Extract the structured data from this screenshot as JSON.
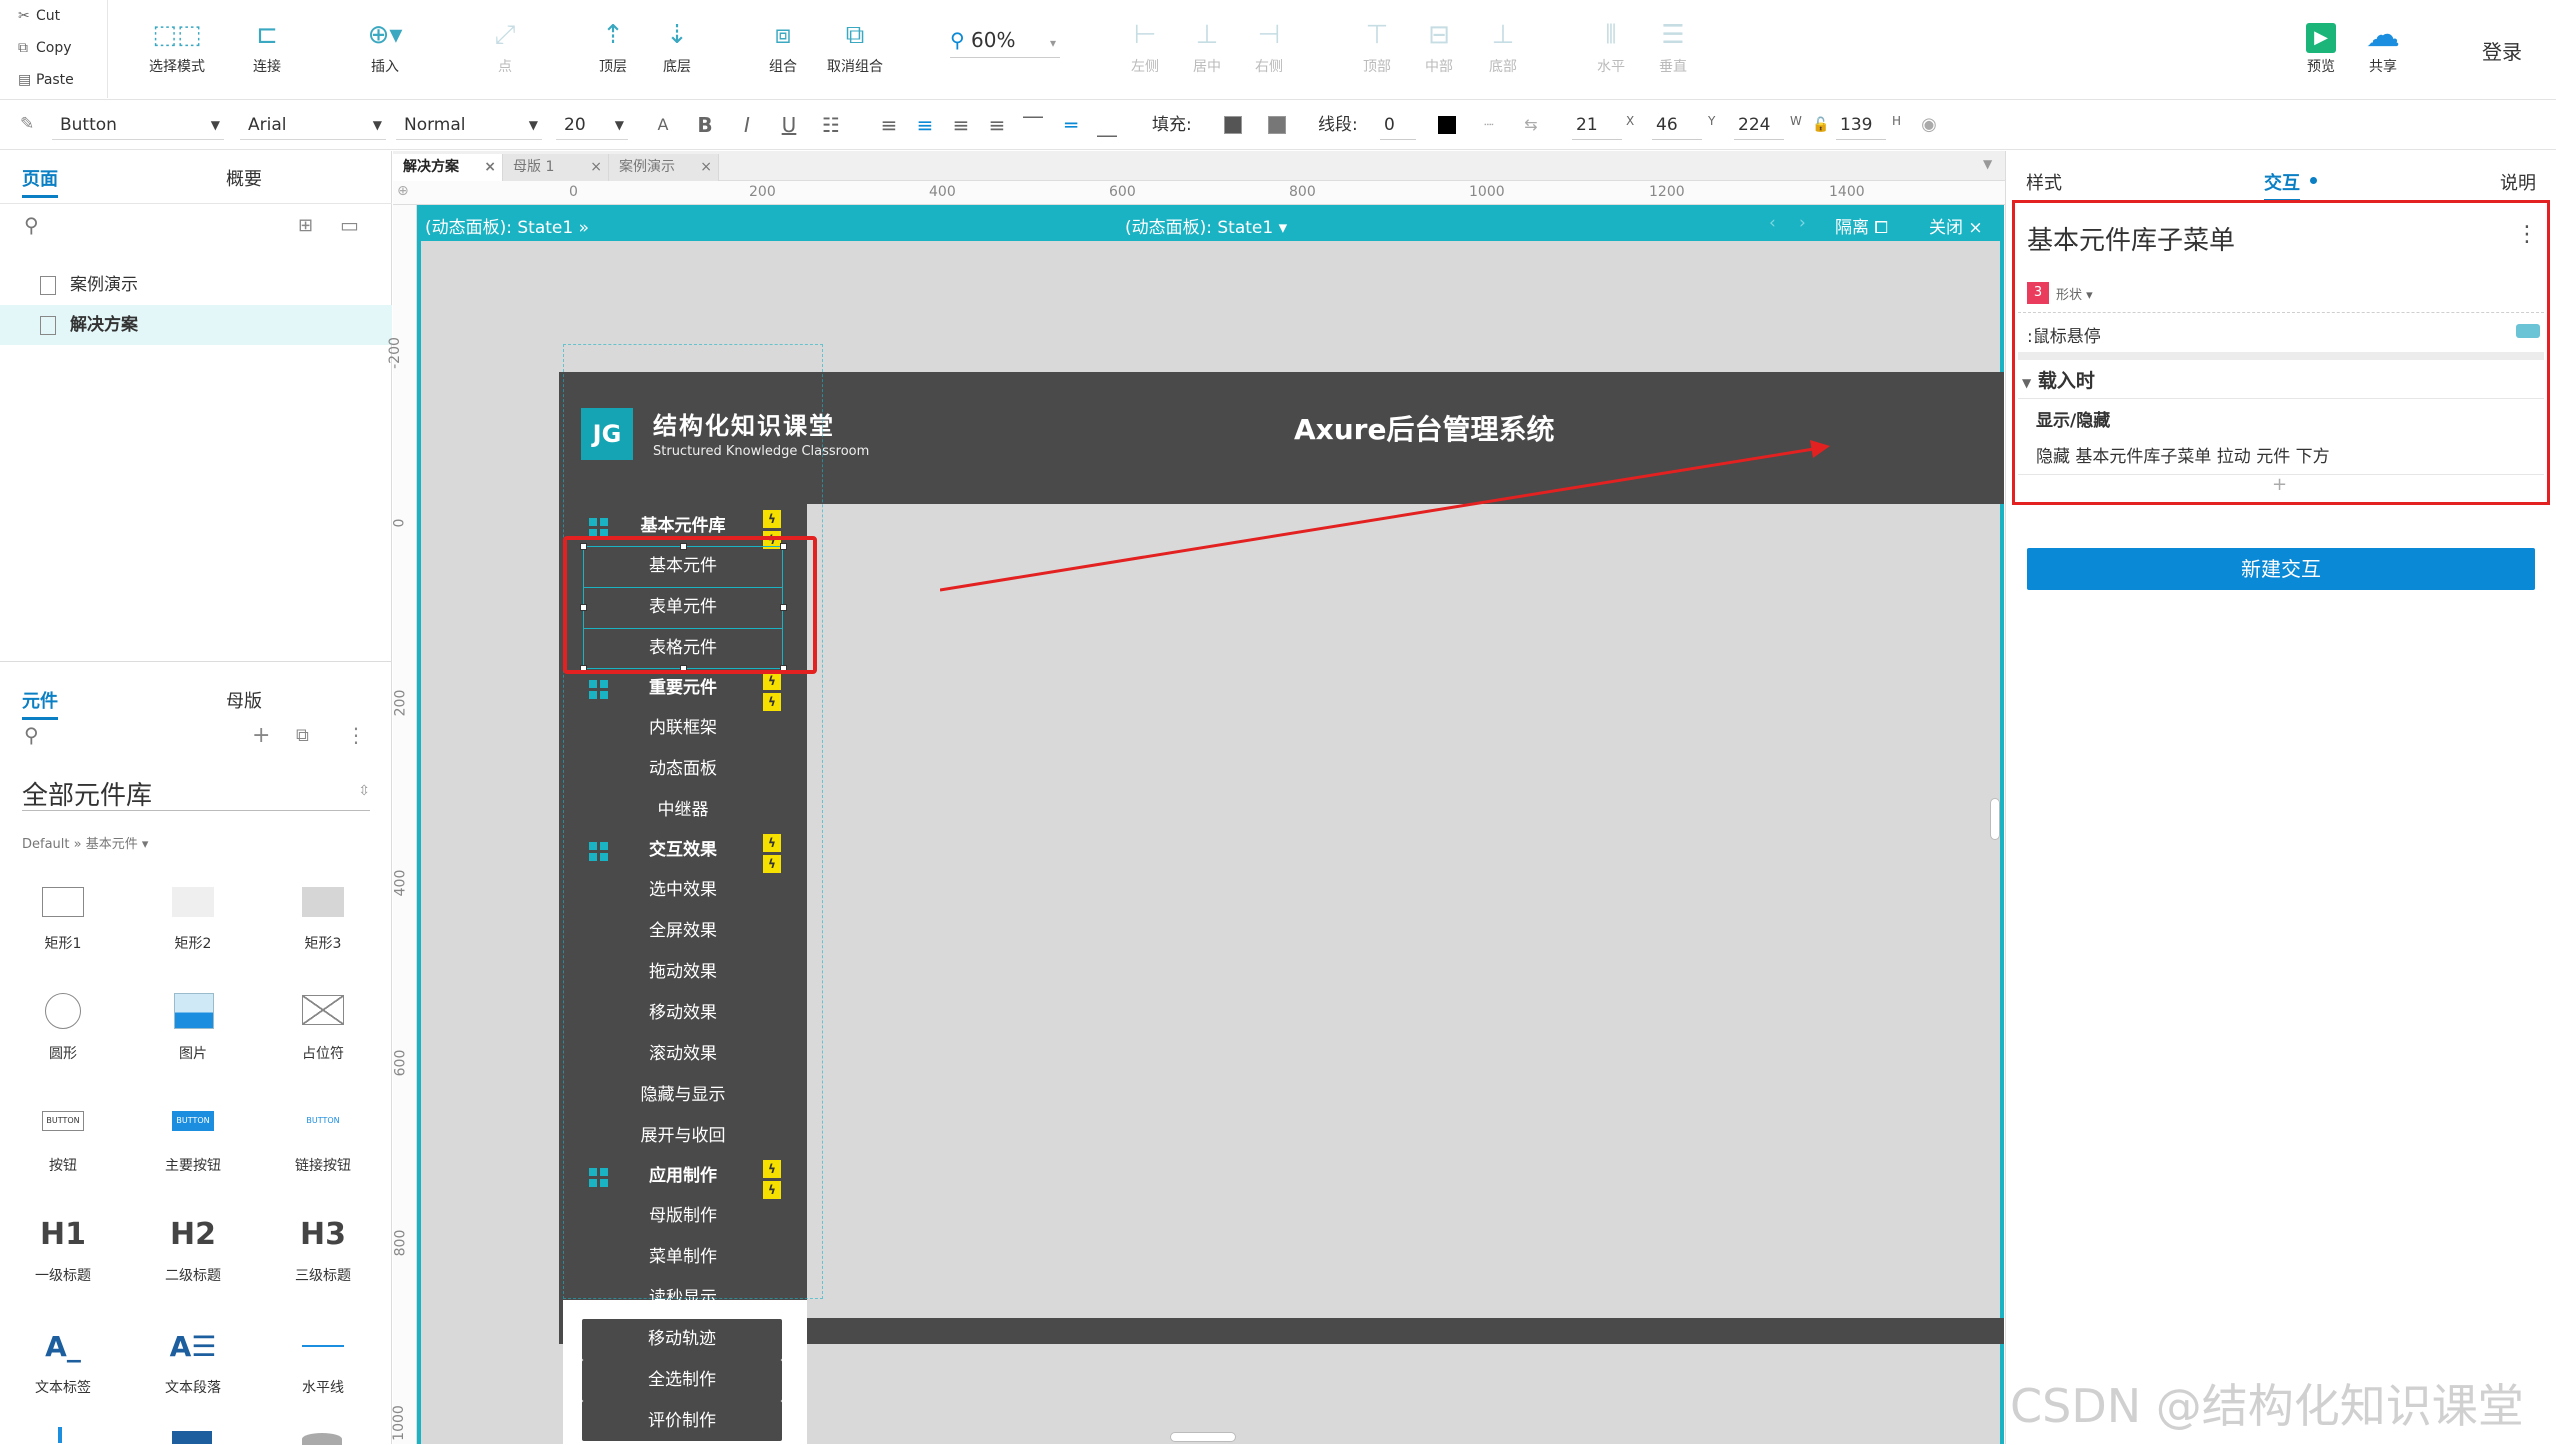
{
  "toolbar": {
    "clipboard": {
      "cut": "Cut",
      "copy": "Copy",
      "paste": "Paste"
    },
    "tools": [
      {
        "label": "选择模式",
        "icon": "select-mode-icon"
      },
      {
        "label": "连接",
        "icon": "connect-icon"
      },
      {
        "label": "插入",
        "icon": "insert-icon"
      },
      {
        "label": "点",
        "icon": "point-icon"
      },
      {
        "label": "顶层",
        "icon": "bring-front-icon"
      },
      {
        "label": "底层",
        "icon": "send-back-icon"
      },
      {
        "label": "组合",
        "icon": "group-icon"
      },
      {
        "label": "取消组合",
        "icon": "ungroup-icon"
      }
    ],
    "zoom": "60%",
    "align": [
      "左侧",
      "居中",
      "右侧",
      "顶部",
      "中部",
      "底部",
      "水平",
      "垂直"
    ],
    "preview": "预览",
    "share": "共享",
    "login": "登录"
  },
  "format_bar": {
    "widget_type": "Button",
    "font": "Arial",
    "style": "Normal",
    "size": "20",
    "fill_label": "填充:",
    "line_label": "线段:",
    "line_value": "0",
    "x": "21",
    "x_label": "X",
    "y": "46",
    "y_label": "Y",
    "w": "224",
    "w_label": "W",
    "h": "139",
    "h_label": "H"
  },
  "left_panel": {
    "tabs": [
      "页面",
      "概要"
    ],
    "pages": [
      "案例演示",
      "解决方案"
    ],
    "active_page": "解决方案",
    "widget_tabs": [
      "元件",
      "母版"
    ],
    "library_title": "全部元件库",
    "library_path": "Default » 基本元件 ▾",
    "widgets": [
      "矩形1",
      "矩形2",
      "矩形3",
      "圆形",
      "图片",
      "占位符",
      "按钮",
      "主要按钮",
      "链接按钮",
      "一级标题",
      "二级标题",
      "三级标题",
      "文本标签",
      "文本段落",
      "水平线"
    ],
    "widget_glyphs": {
      "h1": "H1",
      "h2": "H2",
      "h3": "H3",
      "btn": "BUTTON"
    }
  },
  "doc_tabs": [
    "解决方案",
    "母版 1",
    "案例演示"
  ],
  "rulers": {
    "h": [
      "0",
      "200",
      "400",
      "600",
      "800",
      "1000",
      "1200",
      "1400"
    ],
    "v": [
      "-200",
      "0",
      "200",
      "400",
      "600",
      "800",
      "1000"
    ]
  },
  "canvas": {
    "dp_left": "(动态面板): State1 »",
    "dp_center": "(动态面板): State1 ▾",
    "isolate": "隔离",
    "close": "关闭",
    "logo": "JG",
    "brand": "结构化知识课堂",
    "brand_en": "Structured Knowledge Classroom",
    "system_title": "Axure后台管理系统",
    "menu": [
      {
        "text": "基本元件库",
        "group": true
      },
      {
        "text": "基本元件"
      },
      {
        "text": "表单元件"
      },
      {
        "text": "表格元件"
      },
      {
        "text": "重要元件",
        "group": true
      },
      {
        "text": "内联框架"
      },
      {
        "text": "动态面板"
      },
      {
        "text": "中继器"
      },
      {
        "text": "交互效果",
        "group": true
      },
      {
        "text": "选中效果"
      },
      {
        "text": "全屏效果"
      },
      {
        "text": "拖动效果"
      },
      {
        "text": "移动效果"
      },
      {
        "text": "滚动效果"
      },
      {
        "text": "隐藏与显示"
      },
      {
        "text": "展开与收回"
      },
      {
        "text": "应用制作",
        "group": true
      },
      {
        "text": "母版制作"
      },
      {
        "text": "菜单制作"
      },
      {
        "text": "读秒显示"
      },
      {
        "text": "移动轨迹"
      },
      {
        "text": "全选制作"
      },
      {
        "text": "评价制作"
      }
    ]
  },
  "right_panel": {
    "tabs": [
      "样式",
      "交互",
      "说明"
    ],
    "widget_name": "基本元件库子菜单",
    "shape_count": "3",
    "shape_label": "形状 ▾",
    "hover_event": ":鼠标悬停",
    "load_event": "载入时",
    "action_title": "显示/隐藏",
    "action_detail": "隐藏 基本元件库子菜单 拉动 元件 下方",
    "add_symbol": "+",
    "new_interaction": "新建交互"
  },
  "watermark": "CSDN @结构化知识课堂",
  "colors": {
    "accent": "#1ab3c4",
    "blue": "#0a89d6",
    "dark": "#4a4a4a",
    "red": "#e32121",
    "bolt": "#f6e000"
  }
}
